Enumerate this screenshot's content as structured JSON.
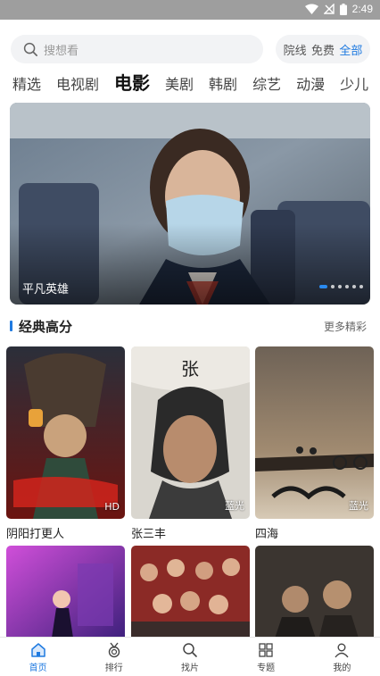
{
  "status_bar": {
    "time": "2:49"
  },
  "search": {
    "placeholder": "搜想看"
  },
  "filters": [
    {
      "label": "院线",
      "active": false
    },
    {
      "label": "免费",
      "active": false
    },
    {
      "label": "全部",
      "active": true
    }
  ],
  "tabs": [
    {
      "label": "精选",
      "active": false
    },
    {
      "label": "电视剧",
      "active": false
    },
    {
      "label": "电影",
      "active": true
    },
    {
      "label": "美剧",
      "active": false
    },
    {
      "label": "韩剧",
      "active": false
    },
    {
      "label": "综艺",
      "active": false
    },
    {
      "label": "动漫",
      "active": false
    },
    {
      "label": "少儿",
      "active": false
    }
  ],
  "banner": {
    "title": "平凡英雄",
    "page_count": 6,
    "current_page": 1
  },
  "section": {
    "title": "经典高分",
    "more": "更多精彩"
  },
  "movies": [
    {
      "title": "阴阳打更人",
      "badge": "HD"
    },
    {
      "title": "张三丰",
      "badge": "蓝光"
    },
    {
      "title": "四海",
      "badge": "蓝光"
    },
    {
      "title": "",
      "badge": ""
    },
    {
      "title": "",
      "badge": ""
    },
    {
      "title": "",
      "badge": ""
    }
  ],
  "bottom_nav": [
    {
      "label": "首页",
      "icon": "home-icon",
      "active": true
    },
    {
      "label": "排行",
      "icon": "medal-icon",
      "active": false
    },
    {
      "label": "找片",
      "icon": "search-icon",
      "active": false
    },
    {
      "label": "专题",
      "icon": "grid-icon",
      "active": false
    },
    {
      "label": "我的",
      "icon": "user-icon",
      "active": false
    }
  ],
  "colors": {
    "accent": "#1f7ae0",
    "search_bg": "#f2f3f5",
    "status_bar": "#9e9e9e"
  }
}
